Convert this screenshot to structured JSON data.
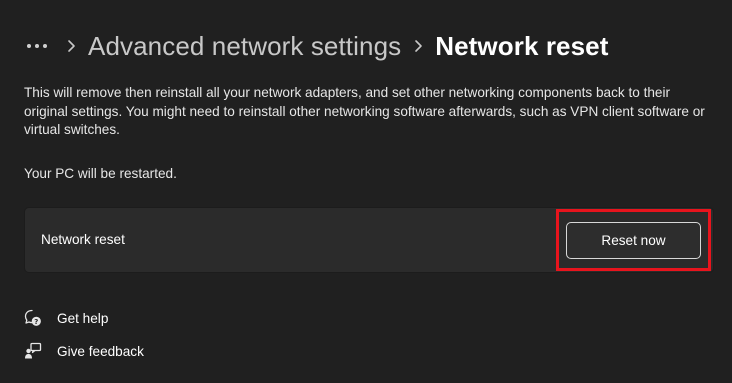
{
  "breadcrumb": {
    "more_icon": "more-horizontal-icon",
    "separator_icon": "chevron-right-icon",
    "parent": "Advanced network settings",
    "current": "Network reset"
  },
  "description": "This will remove then reinstall all your network adapters, and set other networking components back to their original settings. You might need to reinstall other networking software afterwards, such as VPN client software or virtual switches.",
  "restart_note": "Your PC will be restarted.",
  "card": {
    "label": "Network reset",
    "button_label": "Reset now",
    "highlight_color": "#e8141d"
  },
  "links": {
    "help": {
      "label": "Get help",
      "icon": "help-chat-icon"
    },
    "feedback": {
      "label": "Give feedback",
      "icon": "feedback-icon"
    }
  },
  "colors": {
    "background": "#202020",
    "card": "#2b2b2b",
    "text": "#ffffff",
    "muted_text": "#c8c8c8"
  }
}
